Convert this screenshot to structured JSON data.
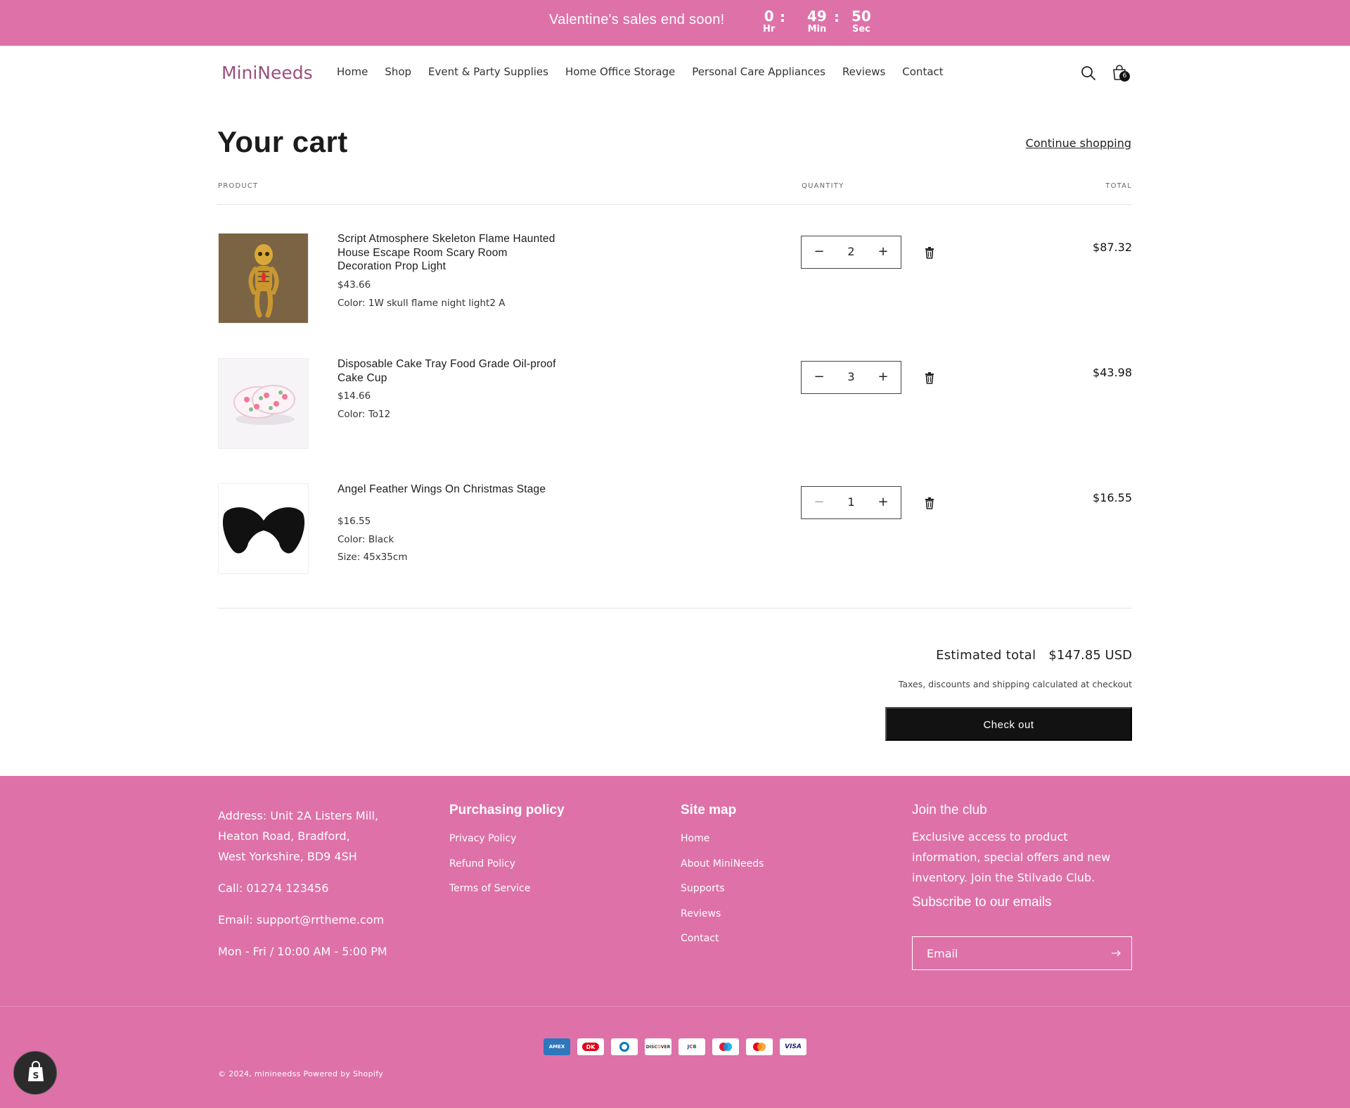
{
  "announcement": {
    "message": "Valentine's sales end soon!",
    "timer": {
      "hours": "0",
      "hours_label": "Hr",
      "minutes": "49",
      "minutes_label": "Min",
      "seconds": "50",
      "seconds_label": "Sec",
      "separator": ":"
    }
  },
  "header": {
    "logo": "MiniNeeds",
    "nav": [
      "Home",
      "Shop",
      "Event & Party Supplies",
      "Home Office Storage",
      "Personal Care Appliances",
      "Reviews",
      "Contact"
    ],
    "cart_count": "6"
  },
  "cart": {
    "title": "Your cart",
    "continue_shopping": "Continue shopping",
    "columns": {
      "product": "PRODUCT",
      "quantity": "QUANTITY",
      "total": "TOTAL"
    },
    "items": [
      {
        "name": "Script Atmosphere Skeleton Flame Haunted House Escape Room Scary Room Decoration Prop Light",
        "price": "$43.66",
        "options": [
          "Color: 1W skull flame night light2 A"
        ],
        "quantity": "2",
        "line_total": "$87.32"
      },
      {
        "name": "Disposable Cake Tray Food Grade Oil-proof Cake Cup",
        "price": "$14.66",
        "options": [
          "Color: To12"
        ],
        "quantity": "3",
        "line_total": "$43.98"
      },
      {
        "name": "Angel Feather Wings On Christmas Stage",
        "price": "$16.55",
        "options": [
          "Color: Black",
          "Size: 45x35cm"
        ],
        "quantity": "1",
        "line_total": "$16.55"
      }
    ],
    "estimated_total_label": "Estimated total",
    "estimated_total": "$147.85 USD",
    "tax_note": "Taxes, discounts and shipping calculated at checkout",
    "checkout_label": "Check out"
  },
  "footer": {
    "address_lines": [
      "Address: Unit 2A Listers Mill,",
      "Heaton Road, Bradford,",
      "West Yorkshire, BD9 4SH"
    ],
    "call": "Call: 01274 123456",
    "email": "Email: support@rrtheme.com",
    "hours": "Mon - Fri / 10:00 AM - 5:00 PM",
    "policy_heading": "Purchasing policy",
    "policy_links": [
      "Privacy Policy",
      "Refund Policy",
      "Terms of Service"
    ],
    "sitemap_heading": "Site map",
    "sitemap_links": [
      "Home",
      "About MiniNeeds",
      "Supports",
      "Reviews",
      "Contact"
    ],
    "club_heading": "Join the club",
    "club_text_lines": [
      "Exclusive access to product",
      "information, special offers and new",
      "inventory. Join the Stilvado Club."
    ],
    "subscribe_heading": "Subscribe to our emails",
    "email_placeholder": "Email",
    "payment_icons": [
      "amex-icon",
      "dankort-icon",
      "diners-club-icon",
      "discover-icon",
      "jcb-icon",
      "maestro-icon",
      "mastercard-icon",
      "visa-icon"
    ],
    "copyright_year": "© 2024,",
    "store_name": "minineedss",
    "powered_by": "Powered by Shopify"
  },
  "colors": {
    "brand_pink": "#de71a8",
    "logo": "#9b4f7c",
    "checkout": "#121212"
  }
}
